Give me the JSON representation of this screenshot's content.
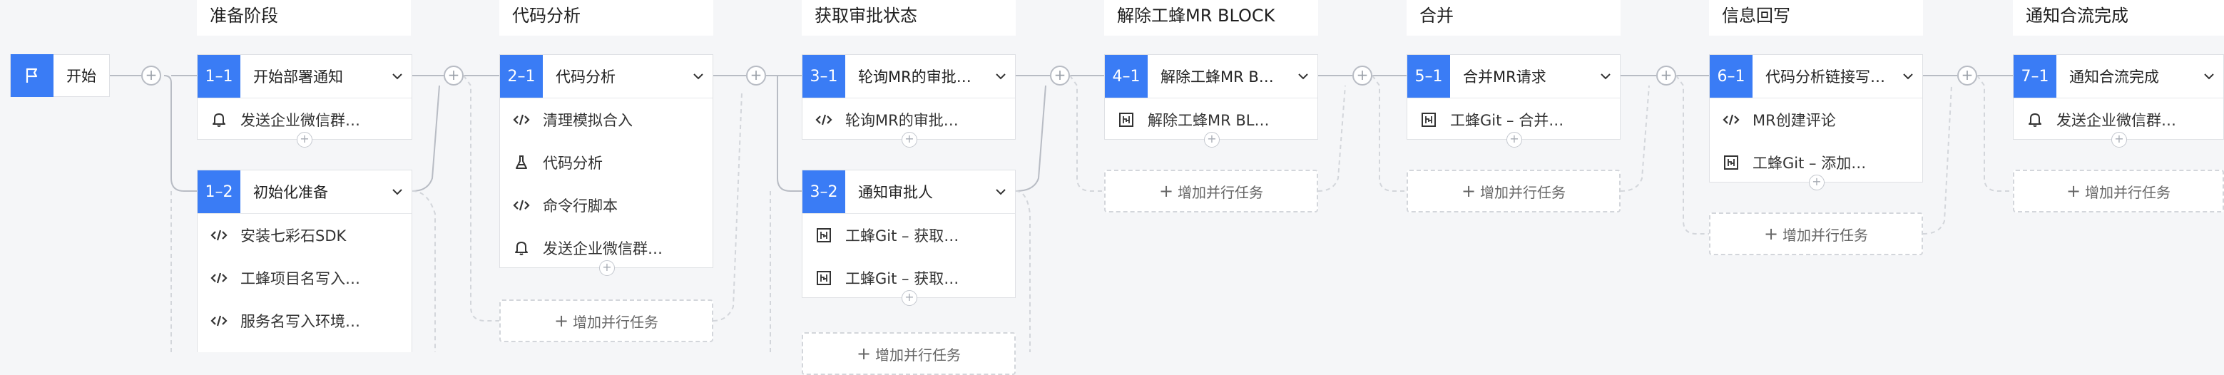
{
  "start": {
    "label": "开始"
  },
  "stages": [
    {
      "title": "准备阶段",
      "tasks": [
        {
          "num": "1–1",
          "title": "开始部署通知",
          "steps": [
            {
              "icon": "bell-icon",
              "text": "发送企业微信群…"
            }
          ]
        },
        {
          "num": "1–2",
          "title": "初始化准备",
          "steps": [
            {
              "icon": "code-icon",
              "text": "安装七彩石SDK"
            },
            {
              "icon": "code-icon",
              "text": "工蜂项目名写入…"
            },
            {
              "icon": "code-icon",
              "text": "服务名写入环境…"
            }
          ]
        }
      ]
    },
    {
      "title": "代码分析",
      "tasks": [
        {
          "num": "2–1",
          "title": "代码分析",
          "steps": [
            {
              "icon": "code-icon",
              "text": "清理模拟合入"
            },
            {
              "icon": "flask-icon",
              "text": "代码分析"
            },
            {
              "icon": "code-icon",
              "text": "命令行脚本"
            },
            {
              "icon": "bell-icon",
              "text": "发送企业微信群…"
            }
          ]
        }
      ],
      "add_label": "增加并行任务"
    },
    {
      "title": "获取审批状态",
      "tasks": [
        {
          "num": "3–1",
          "title": "轮询MR的审批…",
          "steps": [
            {
              "icon": "code-icon",
              "text": "轮询MR的审批…"
            }
          ]
        },
        {
          "num": "3–2",
          "title": "通知审批人",
          "steps": [
            {
              "icon": "git-icon",
              "text": "工蜂Git – 获取…"
            },
            {
              "icon": "git-icon",
              "text": "工蜂Git – 获取…"
            }
          ]
        }
      ],
      "add_label": "增加并行任务"
    },
    {
      "title": "解除工蜂MR BLOCK",
      "tasks": [
        {
          "num": "4–1",
          "title": "解除工蜂MR B…",
          "steps": [
            {
              "icon": "git-icon",
              "text": "解除工蜂MR BL…"
            }
          ]
        }
      ],
      "add_label": "增加并行任务"
    },
    {
      "title": "合并",
      "tasks": [
        {
          "num": "5–1",
          "title": "合并MR请求",
          "steps": [
            {
              "icon": "git-icon",
              "text": "工蜂Git – 合并…"
            }
          ]
        }
      ],
      "add_label": "增加并行任务"
    },
    {
      "title": "信息回写",
      "tasks": [
        {
          "num": "6–1",
          "title": "代码分析链接写…",
          "steps": [
            {
              "icon": "code-icon",
              "text": "MR创建评论"
            },
            {
              "icon": "git-icon",
              "text": "工蜂Git – 添加…"
            }
          ]
        }
      ],
      "add_label": "增加并行任务"
    },
    {
      "title": "通知合流完成",
      "tasks": [
        {
          "num": "7–1",
          "title": "通知合流完成",
          "steps": [
            {
              "icon": "bell-icon",
              "text": "发送企业微信群…"
            }
          ]
        }
      ],
      "add_label": "增加并行任务"
    }
  ]
}
